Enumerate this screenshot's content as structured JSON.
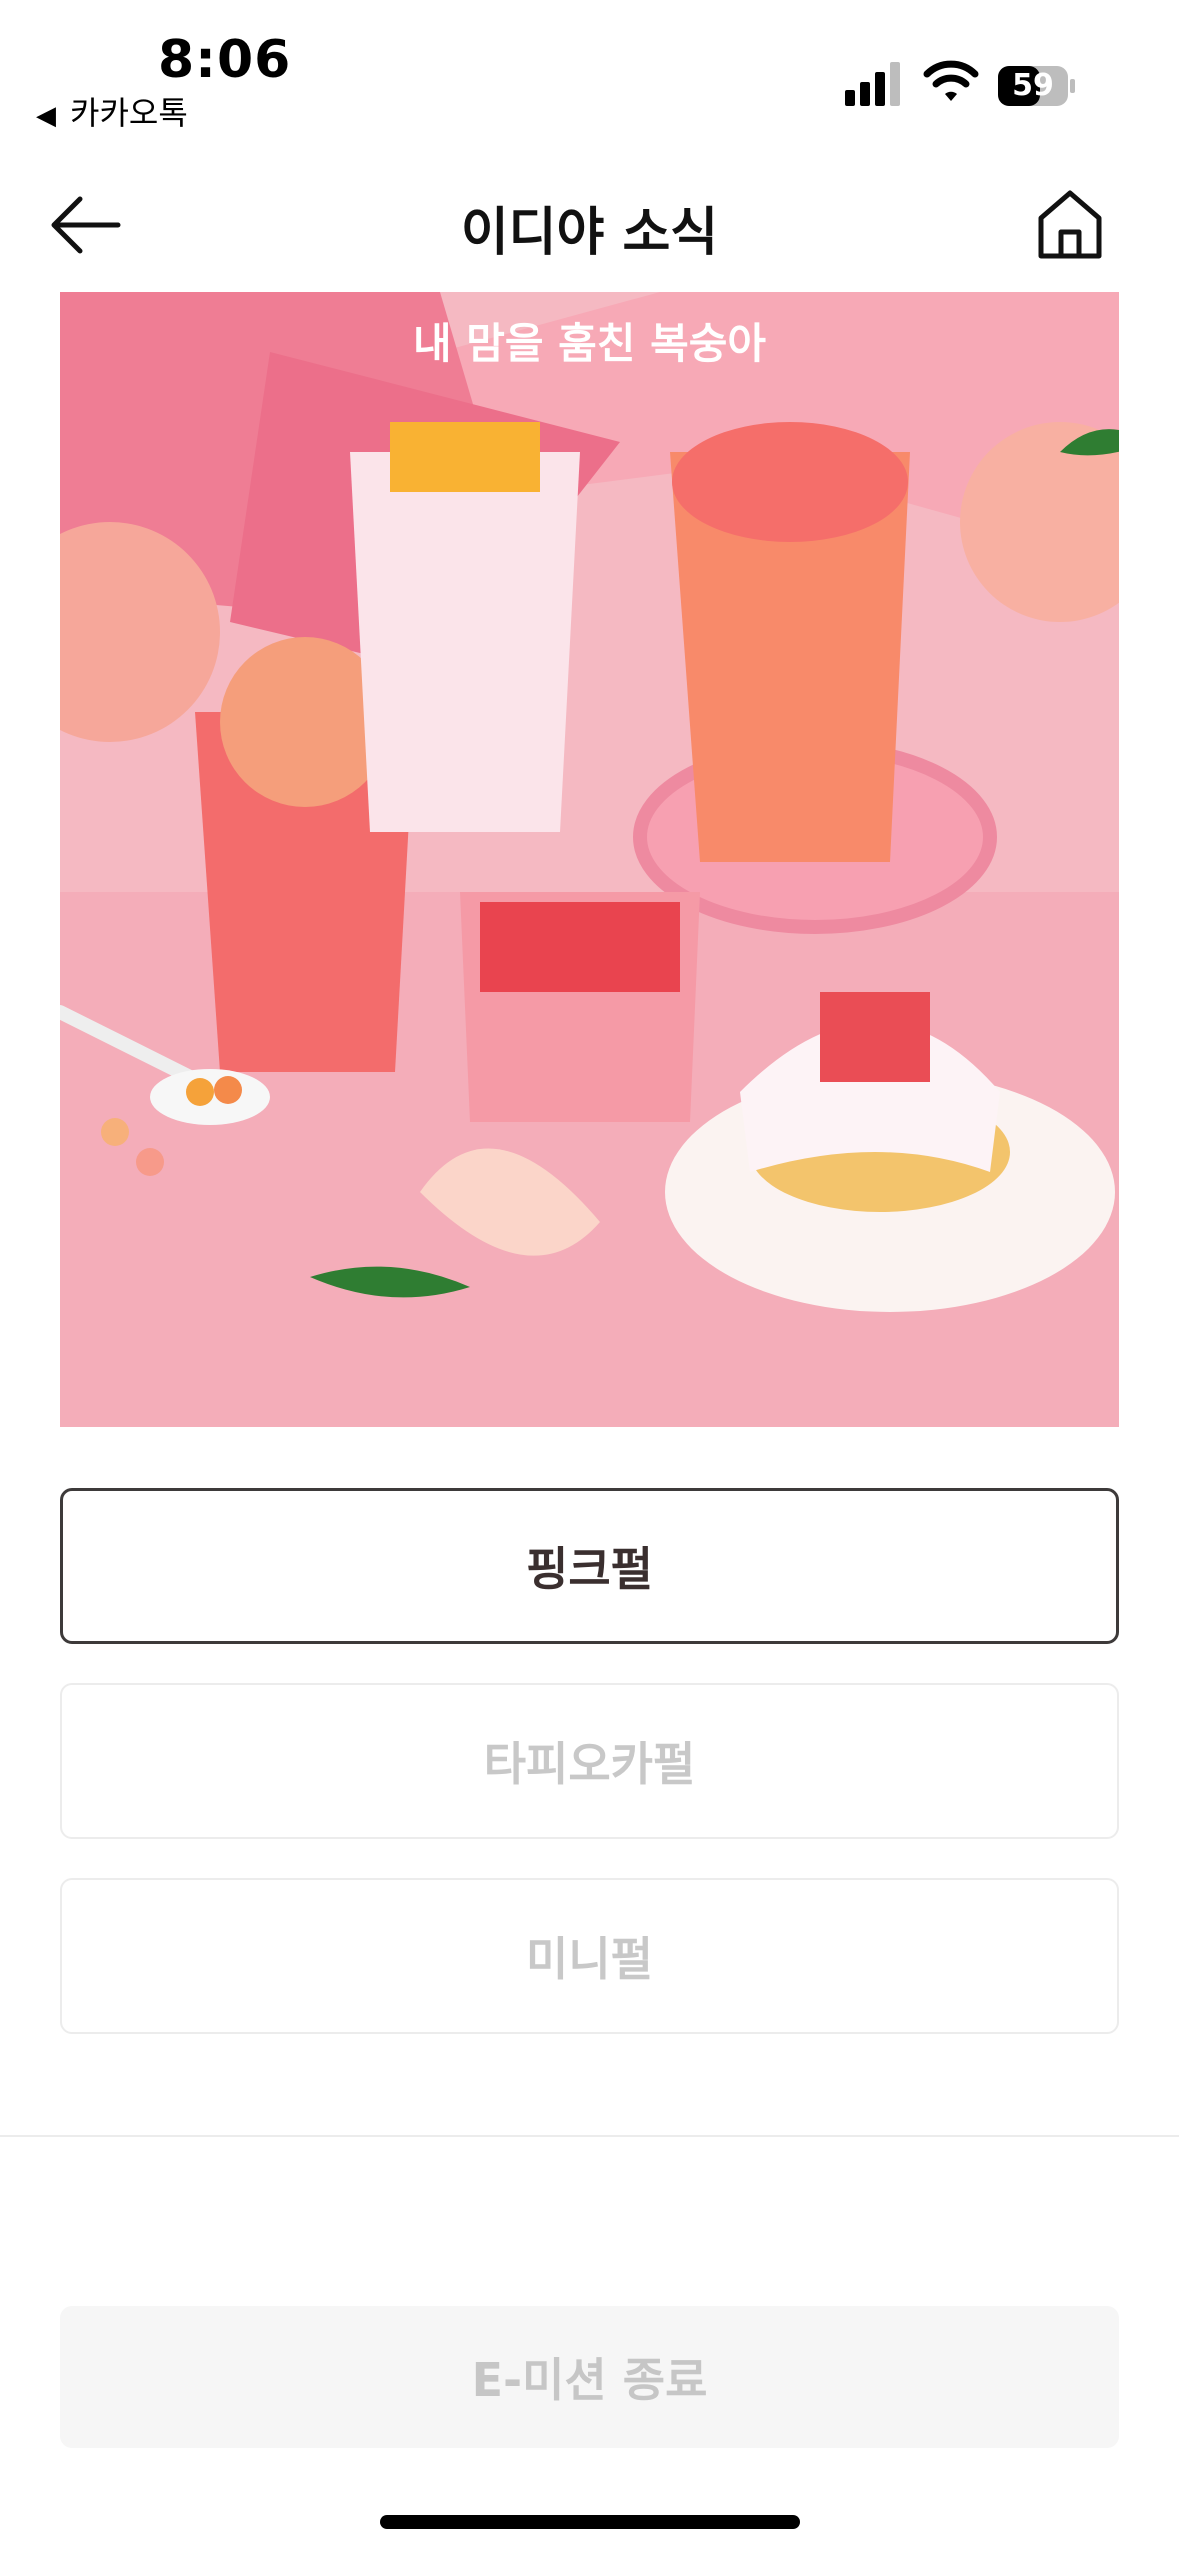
{
  "status_bar": {
    "time": "8:06",
    "back_app": "카카오톡",
    "back_icon": "triangle-left",
    "battery": "59"
  },
  "header": {
    "title": "이디야 소식",
    "back_icon": "arrow-left-icon",
    "home_icon": "home-icon"
  },
  "banner": {
    "caption": "내 맘을 훔친 복숭아"
  },
  "options": [
    {
      "label": "핑크펄",
      "selected": true
    },
    {
      "label": "타피오카펄",
      "selected": false
    },
    {
      "label": "미니펄",
      "selected": false
    }
  ],
  "footer": {
    "end_button": "E-미션 종료"
  },
  "colors": {
    "banner_pink": "#f5b9c2",
    "banner_deep_pink": "#ec6f8a",
    "selected_border": "#3d3a3a",
    "disabled_text": "#c8c8c8"
  }
}
